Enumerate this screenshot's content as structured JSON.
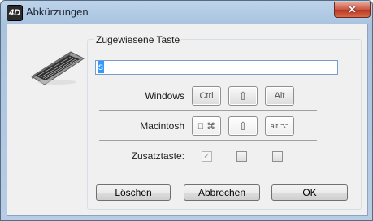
{
  "window": {
    "title": "Abkürzungen",
    "close_label": "✕",
    "app_icon_glyph": "4D"
  },
  "group": {
    "label": "Zugewiesene Taste"
  },
  "input": {
    "value": "s"
  },
  "rows": {
    "windows": {
      "label": "Windows",
      "keys": [
        "Ctrl",
        "⇧",
        "Alt"
      ]
    },
    "macintosh": {
      "label": "Macintosh",
      "keys": [
        " ⌘",
        "⇧",
        "alt ⌥"
      ]
    },
    "modifier": {
      "label": "Zusatztaste:",
      "checkbox_first": "✓"
    }
  },
  "buttons": {
    "delete": "Löschen",
    "cancel": "Abbrechen",
    "ok": "OK"
  },
  "icons": {
    "keyboard": "keyboard-icon",
    "close": "close-icon"
  }
}
